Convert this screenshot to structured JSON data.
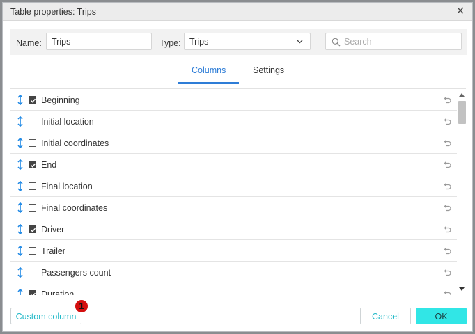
{
  "dialog": {
    "title": "Table properties: Trips"
  },
  "filters": {
    "name_label": "Name:",
    "name_value": "Trips",
    "type_label": "Type:",
    "type_value": "Trips",
    "search_placeholder": "Search"
  },
  "tabs": [
    {
      "label": "Columns",
      "active": true
    },
    {
      "label": "Settings",
      "active": false
    }
  ],
  "columns": [
    {
      "label": "Beginning",
      "checked": true
    },
    {
      "label": "Initial location",
      "checked": false
    },
    {
      "label": "Initial coordinates",
      "checked": false
    },
    {
      "label": "End",
      "checked": true
    },
    {
      "label": "Final location",
      "checked": false
    },
    {
      "label": "Final coordinates",
      "checked": false
    },
    {
      "label": "Driver",
      "checked": true
    },
    {
      "label": "Trailer",
      "checked": false
    },
    {
      "label": "Passengers count",
      "checked": false
    },
    {
      "label": "Duration",
      "checked": true
    }
  ],
  "footer": {
    "custom_column_label": "Custom column",
    "cancel_label": "Cancel",
    "ok_label": "OK",
    "marker_number": "1"
  },
  "colors": {
    "accent": "#2e7dd7",
    "teal": "#1fb8c7",
    "ok_bg": "#31e6e6",
    "marker": "#d40f0f"
  },
  "icons": {
    "close": "close-icon",
    "dropdown": "chevron-down-icon",
    "search": "search-icon",
    "drag": "drag-handle-icon",
    "reset": "reset-icon"
  }
}
